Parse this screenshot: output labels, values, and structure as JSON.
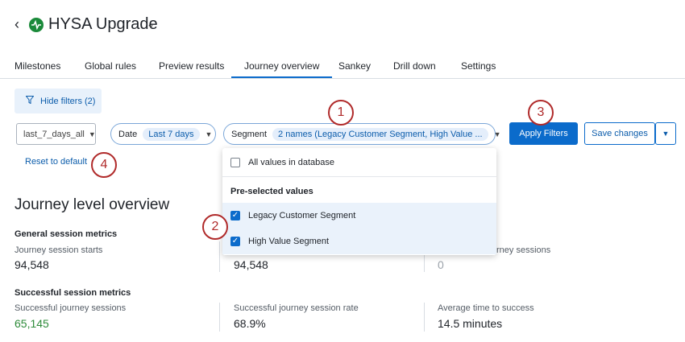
{
  "header": {
    "back_icon": "chevron-left-icon",
    "title": "HYSA Upgrade",
    "app_icon": "activity-icon"
  },
  "tabs": [
    {
      "label": "Milestones"
    },
    {
      "label": "Global rules"
    },
    {
      "label": "Preview results"
    },
    {
      "label": "Journey overview",
      "active": true
    },
    {
      "label": "Sankey"
    },
    {
      "label": "Drill down"
    },
    {
      "label": "Settings"
    }
  ],
  "filters": {
    "hide_label": "Hide filters (2)",
    "range_select": "last_7_days_all",
    "date_label": "Date",
    "date_value": "Last 7 days",
    "segment_label": "Segment",
    "segment_value": "2 names (Legacy Customer Segment, High Value ...",
    "apply_label": "Apply Filters",
    "save_label": "Save changes",
    "reset_label": "Reset to default"
  },
  "dropdown": {
    "all_values": "All values in database",
    "preselected_header": "Pre-selected values",
    "options": [
      {
        "label": "Legacy Customer Segment",
        "checked": true
      },
      {
        "label": "High Value Segment",
        "checked": true
      }
    ]
  },
  "annotations": [
    "1",
    "2",
    "3",
    "4"
  ],
  "overview": {
    "title": "Journey level overview",
    "general": {
      "title": "General session metrics",
      "metrics": [
        {
          "label": "Journey session starts",
          "value": "94,548"
        },
        {
          "label": "",
          "value": "94,548"
        },
        {
          "label": "rney sessions",
          "value": "0"
        }
      ]
    },
    "successful": {
      "title": "Successful session metrics",
      "metrics": [
        {
          "label": "Successful journey sessions",
          "value": "65,145"
        },
        {
          "label": "Successful journey session rate",
          "value": "68.9%"
        },
        {
          "label": "Average time to success",
          "value": "14.5 minutes"
        }
      ]
    }
  },
  "colors": {
    "accent": "#0b6bcb",
    "success": "#2e8b3a",
    "annotation": "#b02a2a",
    "brand_icon": "#1b8a3a"
  }
}
